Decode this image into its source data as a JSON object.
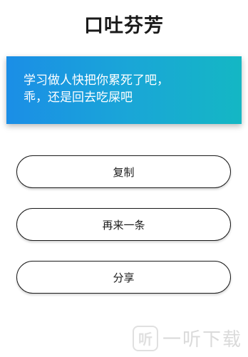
{
  "page": {
    "title": "口吐芬芳"
  },
  "quote": {
    "text": " 学习做人快把你累死了吧，\n乖，还是回去吃屎吧"
  },
  "buttons": {
    "copy_label": "复制",
    "next_label": "再来一条",
    "share_label": "分享"
  },
  "watermark": {
    "logo_text": "听",
    "brand_text": "一听下载"
  },
  "colors": {
    "gradient_start": "#1b8ee6",
    "gradient_end": "#14b7c4",
    "button_border": "#1a1a1a"
  }
}
